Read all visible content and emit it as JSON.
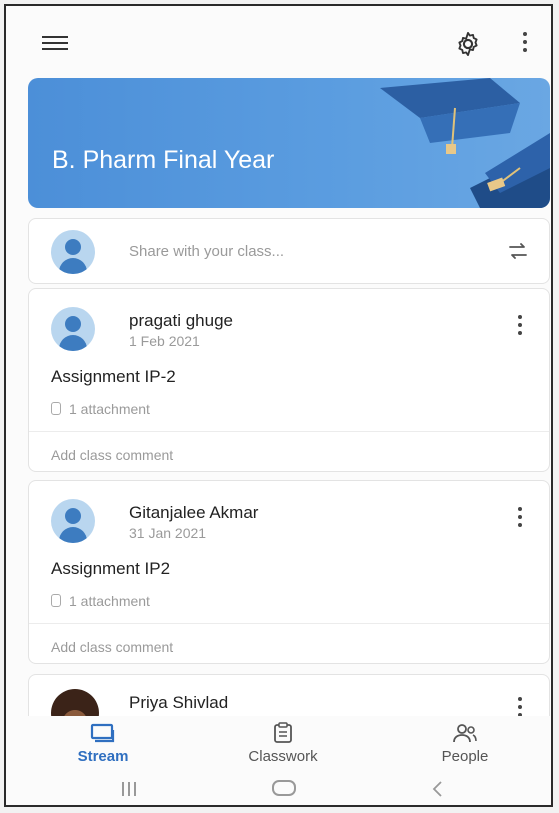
{
  "class": {
    "name": "B. Pharm Final Year"
  },
  "share": {
    "placeholder": "Share with your class..."
  },
  "posts": [
    {
      "author": "pragati ghuge",
      "date": "1 Feb 2021",
      "title": "Assignment IP-2",
      "attachment": "1 attachment",
      "comment": "Add class comment"
    },
    {
      "author": "Gitanjalee Akmar",
      "date": "31 Jan 2021",
      "title": "Assignment IP2",
      "attachment": "1 attachment",
      "comment": "Add class comment"
    },
    {
      "author": "Priya Shivlad"
    }
  ],
  "nav": [
    {
      "label": "Stream",
      "icon": "stream-icon",
      "active": true
    },
    {
      "label": "Classwork",
      "icon": "classwork-icon",
      "active": false
    },
    {
      "label": "People",
      "icon": "people-icon",
      "active": false
    }
  ],
  "colors": {
    "banner": "#4c8fd8",
    "accent": "#2f6fc0"
  }
}
